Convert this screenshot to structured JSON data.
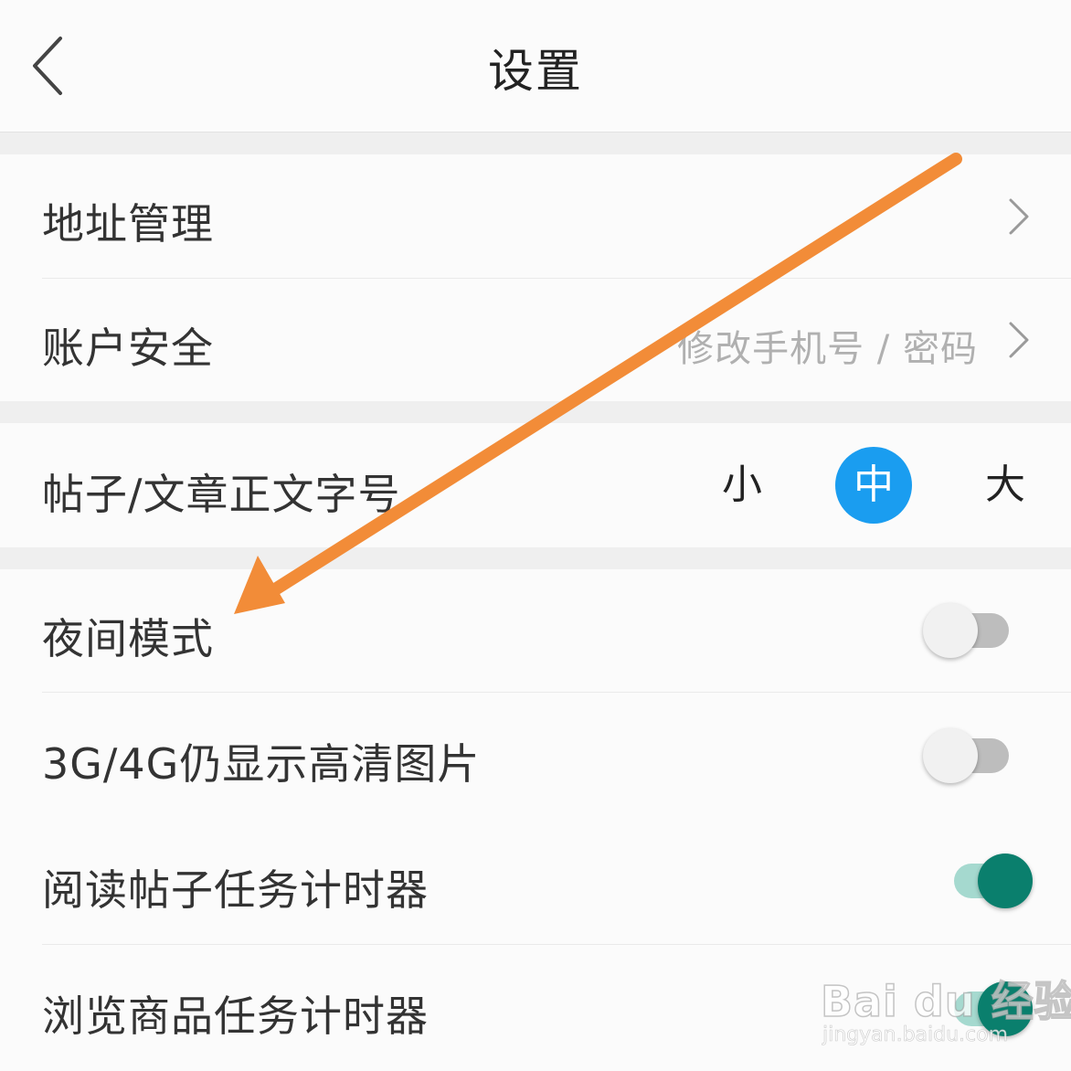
{
  "header": {
    "title": "设置"
  },
  "rows": {
    "address": {
      "label": "地址管理"
    },
    "account": {
      "label": "账户安全",
      "hint": "修改手机号 / 密码"
    },
    "font_size": {
      "label": "帖子/文章正文字号",
      "options": [
        "小",
        "中",
        "大"
      ],
      "selected": "中"
    },
    "night_mode": {
      "label": "夜间模式",
      "enabled": false
    },
    "hd_images": {
      "label": "3G/4G仍显示高清图片",
      "enabled": false
    },
    "read_timer": {
      "label": "阅读帖子任务计时器",
      "enabled": true
    },
    "browse_timer": {
      "label": "浏览商品任务计时器",
      "enabled": true
    }
  },
  "colors": {
    "accent_blue": "#1a9df0",
    "toggle_on": "#0a7f6d",
    "annotation_arrow": "#f28c38"
  },
  "watermark": {
    "logo": "Bai du 经验",
    "url": "jingyan.baidu.com"
  }
}
